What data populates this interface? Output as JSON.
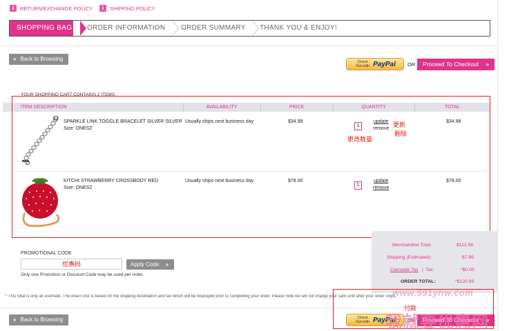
{
  "policies": {
    "return": "RETURN/EXCHANGE POLICY",
    "shipping": "SHIPPING POLICY"
  },
  "steps": [
    "SHOPPING BAG",
    "ORDER INFORMATION",
    "ORDER SUMMARY",
    "THANK YOU & ENJOY!"
  ],
  "actions": {
    "back": "Back to Browsing",
    "or": "OR",
    "proceed": "Proceed To Checkout",
    "paypal_small": "Check Out with",
    "paypal_brand": "PayPal"
  },
  "cart": {
    "summary": "YOUR SHOPPING CART CONTAINS 2 ITEMS",
    "columns": [
      "ITEM DESCRIPTION",
      "AVAILABILITY",
      "PRICE",
      "QUANTITY",
      "TOTAL"
    ],
    "items": [
      {
        "name": "SPARKLE LINK TOGGLE BRACELET SILVER SILVER",
        "size": "Size: ONESZ",
        "availability": "Usually ships next business day",
        "price": "$34.98",
        "qty": "1",
        "update": "update",
        "remove": "remove",
        "total": "$34.98"
      },
      {
        "name": "KITCHI STRAWBERRY CROSSBODY RED",
        "size": "Size: ONESZ",
        "availability": "Usually ships next business day",
        "price": "$78.00",
        "qty": "1",
        "update": "update",
        "remove": "remove",
        "total": "$78.00"
      }
    ]
  },
  "annotations": {
    "update_cn": "更新",
    "remove_cn": "删除",
    "qty_cn": "更改数量",
    "promo_cn": "优惠码",
    "checkout_cn": "付款"
  },
  "promo": {
    "label": "PROMOTIONAL CODE",
    "apply": "Apply Code",
    "note": "Only one Promotion or Discount Code may be used per order."
  },
  "totals": {
    "merch_label": "Merchandise Total:",
    "merch_value": "$112.98",
    "ship_label": "Shipping (Estimated):",
    "ship_value": "$7.95",
    "tax_label": "Calculate Tax",
    "tax_sep": "|",
    "tax_word": "Tax:",
    "tax_value": "*$0.00",
    "order_label": "ORDER TOTAL:",
    "order_value": "*$120.93"
  },
  "disclaimer": "* This total is only an estimate. The exact cost is based on the shipping destination and tax which will be displayed prior to completing your order. Please note we will not charge your card until after your order ships.",
  "watermark": {
    "url": "www.591yhw.com",
    "name": "我就要优惠网"
  },
  "colors": {
    "accent": "#e0338a",
    "annotation": "#e02020"
  }
}
